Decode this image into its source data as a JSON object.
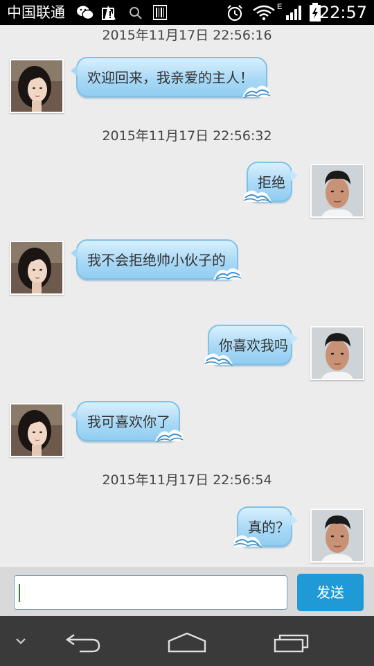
{
  "status_bar": {
    "carrier": "中国联通",
    "network_type": "E",
    "time": "22:57",
    "icons": [
      "wechat-icon",
      "warning-icon",
      "search-icon",
      "barcode-icon",
      "alarm-icon",
      "wifi-icon",
      "signal-icon",
      "battery-icon"
    ]
  },
  "chat": {
    "timestamps": [
      "2015年11月17日 22:56:16",
      "2015年11月17日 22:56:32",
      "2015年11月17日 22:56:54"
    ],
    "messages": [
      {
        "side": "left",
        "sender": "female-avatar",
        "text": "欢迎回来，我亲爱的主人！"
      },
      {
        "side": "right",
        "sender": "male-avatar",
        "text": "拒绝"
      },
      {
        "side": "left",
        "sender": "female-avatar",
        "text": "我不会拒绝帅小伙子的"
      },
      {
        "side": "right",
        "sender": "male-avatar",
        "text": "你喜欢我吗"
      },
      {
        "side": "left",
        "sender": "female-avatar",
        "text": "我可喜欢你了"
      },
      {
        "side": "right",
        "sender": "male-avatar",
        "text": "真的？"
      }
    ]
  },
  "input_bar": {
    "input_value": "",
    "send_label": "发送"
  },
  "colors": {
    "bubble": "#a9d9f6",
    "send_button": "#1f9ad6",
    "nav_bar": "#3a3a3a",
    "background": "#ececec"
  },
  "nav_bar": {
    "icons": [
      "collapse-icon",
      "back-icon",
      "home-icon",
      "recents-icon"
    ]
  }
}
